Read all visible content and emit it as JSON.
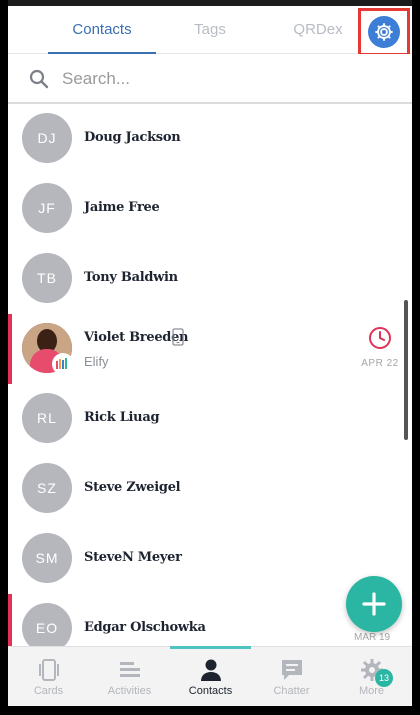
{
  "tabs": [
    {
      "label": "Contacts",
      "active": true
    },
    {
      "label": "Tags",
      "active": false
    },
    {
      "label": "QRDex",
      "active": false
    }
  ],
  "settings_icon": "gear-icon",
  "search": {
    "placeholder": "Search..."
  },
  "contacts": [
    {
      "initials": "DJ",
      "name": "Doug Jackson"
    },
    {
      "initials": "JF",
      "name": "Jaime Free"
    },
    {
      "initials": "TB",
      "name": "Tony Baldwin"
    },
    {
      "initials": "",
      "name": "Violet Breeden",
      "company": "Elify",
      "reminder_date": "APR 22"
    },
    {
      "initials": "RL",
      "name": "Rick Liuag"
    },
    {
      "initials": "SZ",
      "name": "Steve Zweigel"
    },
    {
      "initials": "SM",
      "name": "SteveN Meyer"
    },
    {
      "initials": "EO",
      "name": "Edgar Olschowka",
      "reminder_date": "MAR 19"
    }
  ],
  "nav": [
    {
      "label": "Cards",
      "icon": "cards-icon",
      "active": false
    },
    {
      "label": "Activities",
      "icon": "activities-icon",
      "active": false
    },
    {
      "label": "Contacts",
      "icon": "contacts-icon",
      "active": true
    },
    {
      "label": "Chatter",
      "icon": "chatter-icon",
      "active": false
    },
    {
      "label": "More",
      "icon": "gear-icon",
      "active": false,
      "badge": "13"
    }
  ],
  "colors": {
    "accent": "#3a6fb0",
    "fab": "#2bb6a3",
    "highlight": "#e0335a"
  }
}
